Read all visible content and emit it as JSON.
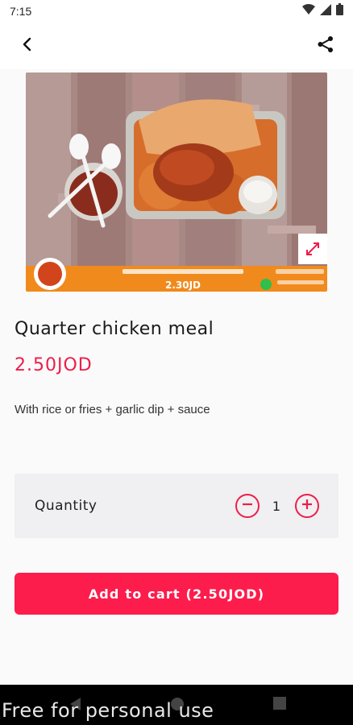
{
  "status_bar": {
    "time": "7:15",
    "icons": [
      "wifi-icon",
      "signal-icon",
      "battery-icon"
    ]
  },
  "app_bar": {
    "back_icon": "back-arrow-icon",
    "share_icon": "share-icon"
  },
  "product": {
    "image": {
      "banner_price": "2.30JD",
      "expand_icon": "expand-icon"
    },
    "title": "Quarter chicken meal",
    "price": "2.50JOD",
    "description": "With rice or fries + garlic dip + sauce"
  },
  "quantity": {
    "label": "Quantity",
    "value": "1",
    "minus_icon": "minus-circle-icon",
    "plus_icon": "plus-circle-icon"
  },
  "cart": {
    "button_label": "Add to cart (2.50JOD)"
  },
  "nav_bar": {
    "icons": [
      "nav-back-icon",
      "nav-home-icon",
      "nav-recents-icon"
    ]
  },
  "watermark": "Free for personal use",
  "colors": {
    "accent": "#ee1d4a",
    "button": "#fc1d4d",
    "card": "#f0eff1",
    "background": "#fafafa",
    "banner": "#f18a1c"
  }
}
